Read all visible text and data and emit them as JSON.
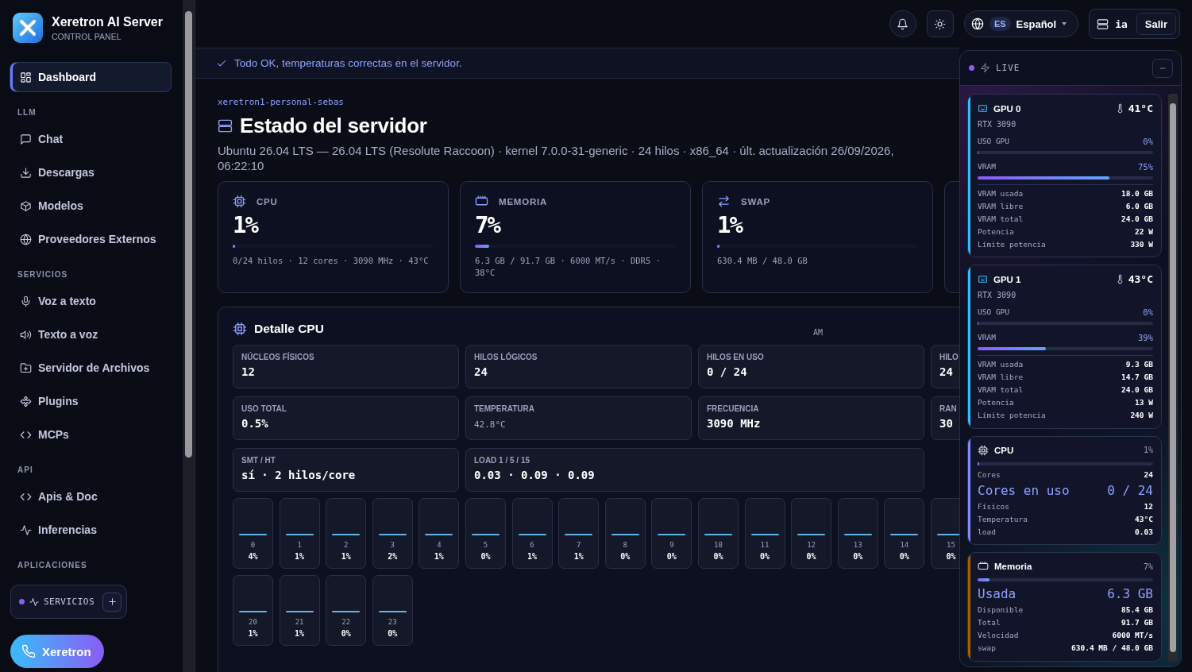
{
  "brand": {
    "name": "Xeretron AI Server",
    "subtitle": "CONTROL PANEL"
  },
  "sidebar": {
    "sections": [
      {
        "items": [
          {
            "label": "Dashboard",
            "selected": true
          }
        ]
      },
      {
        "title": "LLM",
        "items": [
          {
            "label": "Chat",
            "selected": false
          },
          {
            "label": "Descargas",
            "selected": false
          },
          {
            "label": "Modelos",
            "selected": false
          },
          {
            "label": "Proveedores Externos",
            "selected": false
          }
        ]
      },
      {
        "title": "SERVICIOS",
        "items": [
          {
            "label": "Voz a texto",
            "selected": false
          },
          {
            "label": "Texto a voz",
            "selected": false
          },
          {
            "label": "Servidor de Archivos",
            "selected": false
          },
          {
            "label": "Plugins",
            "selected": false
          },
          {
            "label": "MCPs",
            "selected": false
          }
        ]
      },
      {
        "title": "API",
        "items": [
          {
            "label": "Apis & Doc",
            "selected": false
          },
          {
            "label": "Inferencias",
            "selected": false
          }
        ]
      },
      {
        "title": "APLICACIONES"
      }
    ]
  },
  "services_dock": {
    "label": "SERVICIOS"
  },
  "call_button": {
    "label": "Xeretron"
  },
  "header": {
    "language": {
      "code": "ES",
      "label": "Español"
    },
    "user": {
      "name": "ia"
    },
    "logout": "Salir"
  },
  "banner": "Todo OK, temperaturas correctas en el servidor.",
  "page": {
    "host": "xeretron1-personal-sebas",
    "title": "Estado del servidor",
    "subtitle": "Ubuntu 26.04 LTS — 26.04 LTS (Resolute Raccoon) · kernel 7.0.0-31-generic · 24 hilos · x86_64 · últ. actualización 26/09/2026, 06:22:10"
  },
  "stat_cards": [
    {
      "label": "CPU",
      "value": "1%",
      "level": 0.01,
      "detail": "0/24 hilos · 12 cores · 3090 MHz · 43°C"
    },
    {
      "label": "MEMORIA",
      "value": "7%",
      "level": 0.07,
      "detail": "6.3 GB / 91.7 GB · 6000 MT/s · DDR5 · 38°C"
    },
    {
      "label": "SWAP",
      "value": "1%",
      "level": 0.01,
      "detail": "630.4 MB / 48.0 GB"
    }
  ],
  "cpu_detail": {
    "title": "Detalle CPU",
    "aside": "AM",
    "cells": [
      {
        "label": "NÚCLEOS FÍSICOS",
        "value": "12",
        "kind": "normal"
      },
      {
        "label": "HILOS LÓGICOS",
        "value": "24",
        "kind": "normal"
      },
      {
        "label": "HILOS EN USO",
        "value": "0 / 24",
        "kind": "normal"
      },
      {
        "label": "HILO",
        "value": "24",
        "kind": "normal"
      },
      {
        "label": "USO TOTAL",
        "value": "0.5%",
        "kind": "normal"
      },
      {
        "label": "TEMPERATURA",
        "value": "42.8°C",
        "kind": "muted"
      },
      {
        "label": "FRECUENCIA",
        "value": "3090 MHz",
        "kind": "normal"
      },
      {
        "label": "RAN",
        "value": "30",
        "kind": "normal"
      },
      {
        "label": "SMT / HT",
        "value": "sí · 2 hilos/core",
        "kind": "normal"
      },
      {
        "label": "LOAD 1 / 5 / 15",
        "value": "0.03 · 0.09 · 0.09",
        "kind": "wide"
      }
    ],
    "core_rows": [
      [
        {
          "label": "0",
          "value": "4%"
        },
        {
          "label": "1",
          "value": "1%"
        },
        {
          "label": "2",
          "value": "1%"
        },
        {
          "label": "3",
          "value": "2%"
        },
        {
          "label": "4",
          "value": "1%"
        },
        {
          "label": "5",
          "value": "0%"
        },
        {
          "label": "6",
          "value": "1%"
        },
        {
          "label": "7",
          "value": "1%"
        },
        {
          "label": "8",
          "value": "0%"
        },
        {
          "label": "9",
          "value": "0%"
        },
        {
          "label": "10",
          "value": "0%"
        },
        {
          "label": "11",
          "value": "0%"
        },
        {
          "label": "12",
          "value": "0%"
        },
        {
          "label": "13",
          "value": "0%"
        },
        {
          "label": "14",
          "value": "0%"
        },
        {
          "label": "15",
          "value": "0%"
        }
      ],
      [
        {
          "label": "20",
          "value": "1%"
        },
        {
          "label": "21",
          "value": "1%"
        },
        {
          "label": "22",
          "value": "0%"
        },
        {
          "label": "23",
          "value": "0%"
        }
      ]
    ]
  },
  "live": {
    "title": "LIVE",
    "cards": [
      {
        "kind": "gpu",
        "color": "#38bdf8",
        "name": "GPU 0",
        "temp": "41°C",
        "model": "RTX 3090",
        "bars": [
          {
            "label": "USO GPU",
            "reading": "0%",
            "level": 0
          },
          {
            "label": "VRAM",
            "reading": "75%",
            "level": 0.75
          }
        ],
        "stats": [
          {
            "label": "VRAM usada",
            "value": "18.0 GB"
          },
          {
            "label": "VRAM libre",
            "value": "6.0 GB"
          },
          {
            "label": "VRAM total",
            "value": "24.0 GB"
          },
          {
            "label": "Potencia",
            "value": "22 W"
          },
          {
            "label": "Límite potencia",
            "value": "330 W"
          }
        ]
      },
      {
        "kind": "gpu",
        "color": "#38bdf8",
        "name": "GPU 1",
        "temp": "43°C",
        "model": "RTX 3090",
        "bars": [
          {
            "label": "USO GPU",
            "reading": "0%",
            "level": 0
          },
          {
            "label": "VRAM",
            "reading": "39%",
            "level": 0.39
          }
        ],
        "stats": [
          {
            "label": "VRAM usada",
            "value": "9.3 GB"
          },
          {
            "label": "VRAM libre",
            "value": "14.7 GB"
          },
          {
            "label": "VRAM total",
            "value": "24.0 GB"
          },
          {
            "label": "Potencia",
            "value": "13 W"
          },
          {
            "label": "Límite potencia",
            "value": "240 W"
          }
        ]
      },
      {
        "kind": "cpu",
        "color": "#818cf8",
        "name": "CPU",
        "reading": "1%",
        "level": 0.01,
        "stats": [
          {
            "label": "Cores",
            "value": "24",
            "big": false
          },
          {
            "label": "Cores en uso",
            "value": "0 / 24",
            "big": true
          },
          {
            "label": "Físicos",
            "value": "12",
            "big": false
          },
          {
            "label": "Temperatura",
            "value": "43°C",
            "big": false
          },
          {
            "label": "load",
            "value": "0.03",
            "big": false
          }
        ]
      },
      {
        "kind": "memory",
        "color": "#a16207",
        "name": "Memoria",
        "reading": "7%",
        "level": 0.07,
        "stats": [
          {
            "label": "Usada",
            "value": "6.3 GB",
            "big": true
          },
          {
            "label": "Disponible",
            "value": "85.4 GB",
            "big": false
          },
          {
            "label": "Total",
            "value": "91.7 GB",
            "big": false
          },
          {
            "label": "Velocidad",
            "value": "6000 MT/s",
            "big": false
          },
          {
            "label": "swap",
            "value": "630.4 MB / 48.0 GB",
            "big": false
          }
        ]
      }
    ]
  }
}
